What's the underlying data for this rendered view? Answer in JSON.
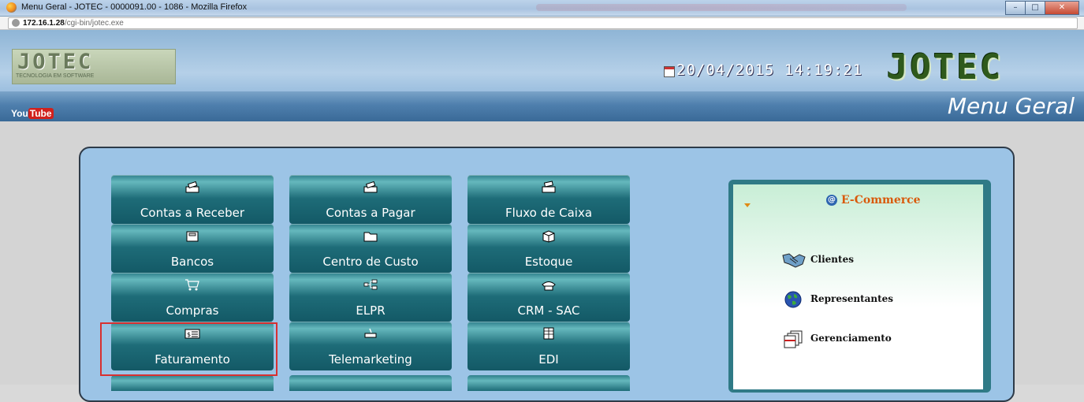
{
  "window": {
    "title": "Menu Geral - JOTEC - 0000091.00 - 1086 - Mozilla Firefox",
    "controls": [
      "–",
      "□",
      "✕"
    ]
  },
  "address": {
    "host": "172.16.1.28",
    "path": "/cgi-bin/jotec.exe"
  },
  "header": {
    "logo_text": "JOTEC",
    "logo_subtitle": "TECNOLOGIA EM SOFTWARE",
    "datetime": "20/04/2015  14:19:21",
    "brand": "JOTEC"
  },
  "navbar": {
    "youtube_you": "You",
    "youtube_tube": "Tube",
    "page_title": "Menu Geral"
  },
  "tiles": [
    {
      "label": "Contas a Receber",
      "icon": "cash-register-icon"
    },
    {
      "label": "Contas a Pagar",
      "icon": "cash-register-icon"
    },
    {
      "label": "Fluxo de Caixa",
      "icon": "cash-register-icon"
    },
    {
      "label": "Bancos",
      "icon": "bank-machine-icon"
    },
    {
      "label": "Centro de Custo",
      "icon": "folder-icon"
    },
    {
      "label": "Estoque",
      "icon": "box-icon"
    },
    {
      "label": "Compras",
      "icon": "shopping-cart-icon"
    },
    {
      "label": "ELPR",
      "icon": "network-icon"
    },
    {
      "label": "CRM - SAC",
      "icon": "telephone-icon"
    },
    {
      "label": "Faturamento",
      "icon": "invoice-icon"
    },
    {
      "label": "Telemarketing",
      "icon": "phone-desk-icon"
    },
    {
      "label": "EDI",
      "icon": "document-grid-icon"
    }
  ],
  "selected_tile": "Faturamento",
  "ecommerce": {
    "title": "E-Commerce",
    "items": [
      {
        "label": "Clientes",
        "icon": "handshake-icon"
      },
      {
        "label": "Representantes",
        "icon": "globe-icon"
      },
      {
        "label": "Gerenciamento",
        "icon": "documents-icon"
      }
    ]
  },
  "colors": {
    "tile": "#1e6c78",
    "selection": "#d83030",
    "ecommerce_title": "#d95a0c",
    "navbar": "#4e7fad"
  }
}
